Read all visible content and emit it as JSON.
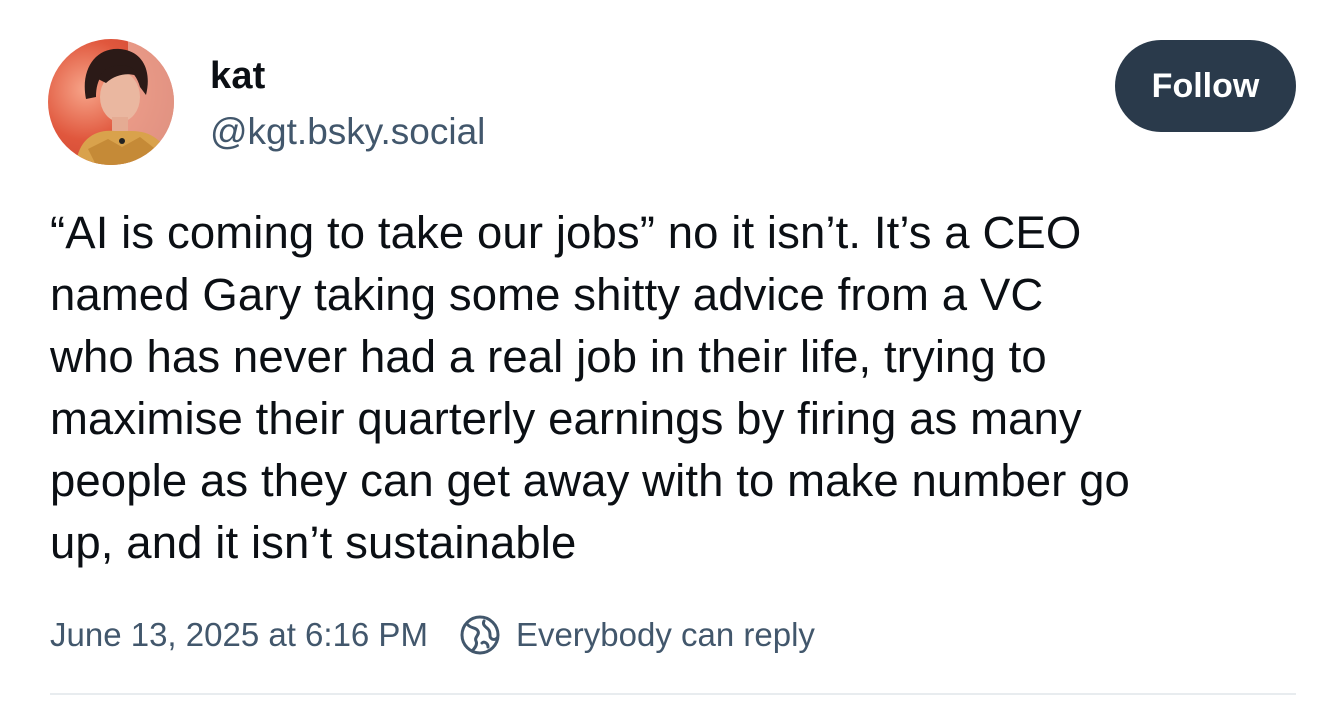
{
  "author": {
    "display_name": "kat",
    "handle": "@kgt.bsky.social"
  },
  "follow_button": {
    "label": "Follow"
  },
  "post": {
    "text": "“AI is coming to take our jobs” no it isn’t. It’s a CEO\nnamed Gary taking some shitty advice from a VC\nwho has never had a real job in their life, trying to\nmaximise their quarterly earnings by firing as many\npeople as they can get away with to make number go\nup, and it isn’t sustainable"
  },
  "meta": {
    "timestamp": "June 13, 2025 at 6:16 PM",
    "reply_setting_icon": "globe-icon",
    "reply_setting": "Everybody can reply"
  },
  "colors": {
    "follow_button_bg": "#2a3a4b",
    "secondary_text": "#42576c",
    "primary_text": "#0b0f14"
  }
}
